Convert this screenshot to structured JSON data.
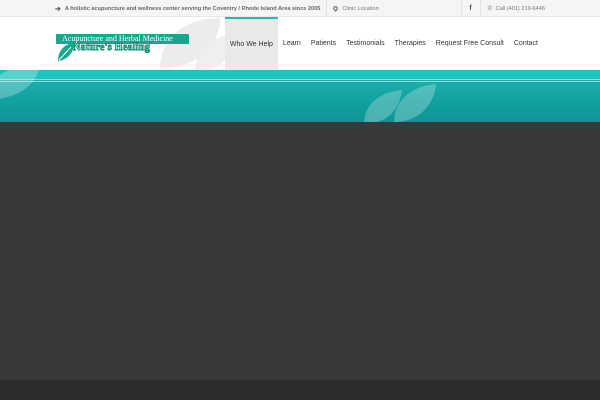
{
  "topbar": {
    "tagline": "A holistic acupuncture and wellness center serving the Coventry / Rhode Island Area since 2005",
    "location_label": "Clinic Location",
    "facebook_glyph": "f",
    "phone_label": "Call (401) 219-6446",
    "icons": [
      "arrow-right-icon",
      "map-pin-icon",
      "facebook-icon",
      "phone-icon"
    ]
  },
  "logo": {
    "top_text": "Acupuncture and Herbal Medicine",
    "name": "Nature's Healing"
  },
  "nav": {
    "items": [
      {
        "label": "Who We Help",
        "active": true
      },
      {
        "label": "Learn",
        "active": false
      },
      {
        "label": "Patients",
        "active": false
      },
      {
        "label": "Testimonials",
        "active": false
      },
      {
        "label": "Therapies",
        "active": false
      },
      {
        "label": "Request Free Consult",
        "active": false
      },
      {
        "label": "Contact",
        "active": false
      }
    ]
  },
  "colors": {
    "accent": "#1dbfb0",
    "banner": "#14a5a5",
    "logo_green": "#12a98e",
    "body_dark": "#37393b",
    "footer_dark": "#2b2d2f"
  }
}
